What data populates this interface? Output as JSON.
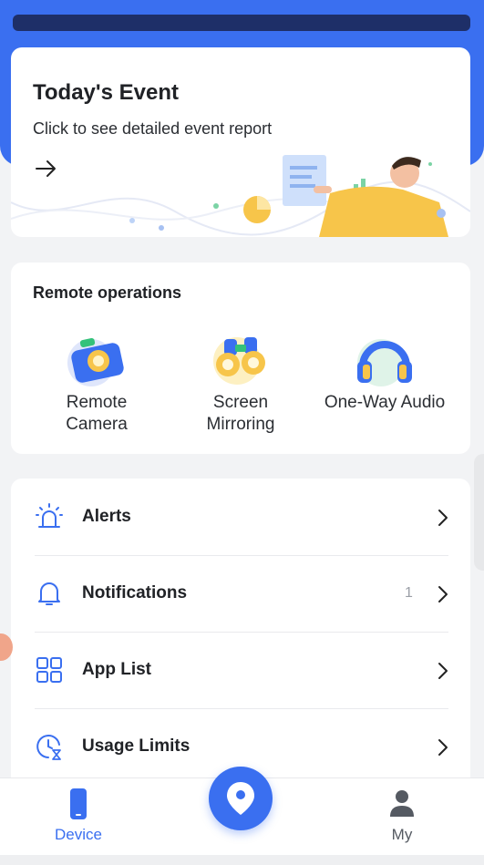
{
  "event_card": {
    "title": "Today's Event",
    "subtitle": "Click to see detailed event report",
    "arrow_icon": "arrow-right-icon"
  },
  "remote_operations": {
    "title": "Remote operations",
    "items": [
      {
        "label_line1": "Remote",
        "label_line2": "Camera",
        "icon": "camera-icon"
      },
      {
        "label_line1": "Screen",
        "label_line2": "Mirroring",
        "icon": "binoculars-icon"
      },
      {
        "label_line1": "One-Way Audio",
        "label_line2": "",
        "icon": "headphones-icon"
      }
    ]
  },
  "menu": {
    "items": [
      {
        "label": "Alerts",
        "icon": "alarm-light-icon",
        "count": ""
      },
      {
        "label": "Notifications",
        "icon": "bell-icon",
        "count": "1"
      },
      {
        "label": "App List",
        "icon": "app-grid-icon",
        "count": ""
      },
      {
        "label": "Usage Limits",
        "icon": "clock-hourglass-icon",
        "count": ""
      }
    ]
  },
  "bottom_nav": {
    "device_label": "Device",
    "my_label": "My",
    "center_icon": "location-pin-icon"
  },
  "colors": {
    "accent": "#3a6ff0",
    "header_dark": "#1e2f68",
    "illustration_yellow": "#f7c54a"
  }
}
